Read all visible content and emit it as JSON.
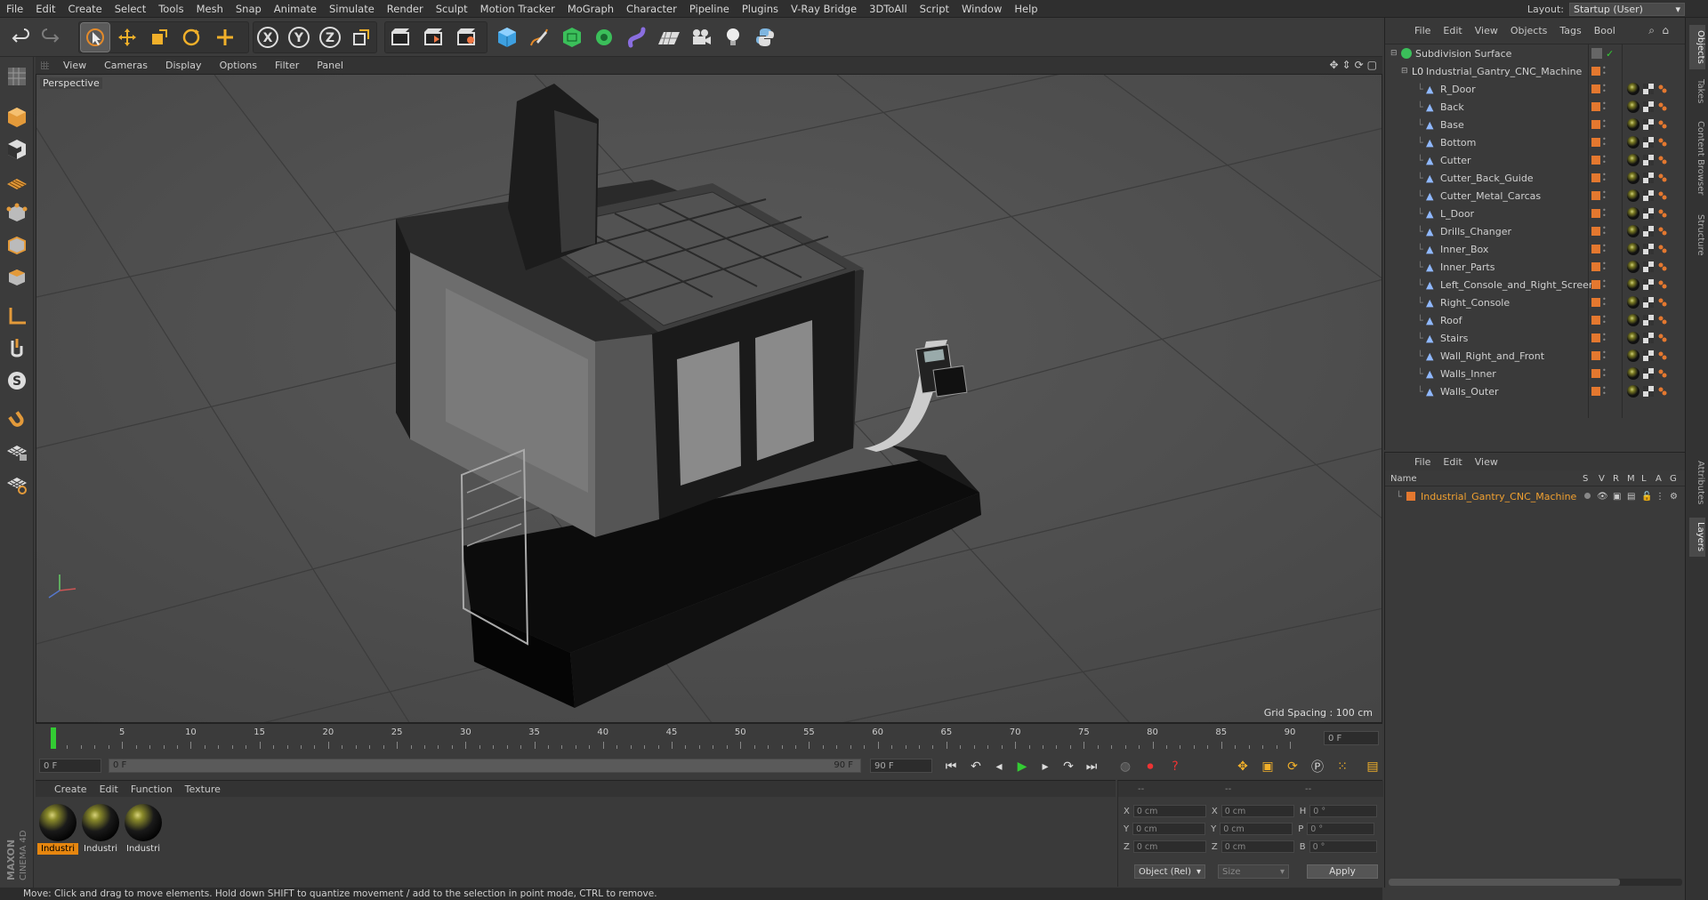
{
  "menubar": {
    "items": [
      "File",
      "Edit",
      "Create",
      "Select",
      "Tools",
      "Mesh",
      "Snap",
      "Animate",
      "Simulate",
      "Render",
      "Sculpt",
      "Motion Tracker",
      "MoGraph",
      "Character",
      "Pipeline",
      "Plugins",
      "V-Ray Bridge",
      "3DToAll",
      "Script",
      "Window",
      "Help"
    ],
    "layout_label": "Layout:",
    "layout_value": "Startup (User)"
  },
  "toolbar": {
    "icons": [
      "undo-icon",
      "redo-icon",
      "live-selection-icon",
      "move-icon",
      "scale-icon",
      "rotate-icon",
      "add-object-icon",
      "x-axis-icon",
      "y-axis-icon",
      "z-axis-icon",
      "coordinate-system-icon",
      "render-view-icon",
      "render-picture-viewer-icon",
      "edit-render-settings-icon",
      "cube-icon",
      "pen-icon",
      "subdivision-icon",
      "cloner-icon",
      "deformer-icon",
      "floor-icon",
      "camera-icon",
      "light-icon",
      "python-icon"
    ]
  },
  "viewport": {
    "menu": [
      "View",
      "Cameras",
      "Display",
      "Options",
      "Filter",
      "Panel"
    ],
    "label": "Perspective",
    "grid_spacing": "Grid Spacing : 100 cm"
  },
  "timeline": {
    "ticks": [
      "0",
      "5",
      "10",
      "15",
      "20",
      "25",
      "30",
      "35",
      "40",
      "45",
      "50",
      "55",
      "60",
      "65",
      "70",
      "75",
      "80",
      "85",
      "90"
    ],
    "current_frame": "0 F",
    "end_frame_field": "0 F",
    "range_start": "0 F",
    "range_start_inner": "0 F",
    "range_end_inner": "90 F",
    "range_end": "90 F"
  },
  "materials": {
    "menu": [
      "Create",
      "Edit",
      "Function",
      "Texture"
    ],
    "items": [
      {
        "label": "Industri",
        "selected": true
      },
      {
        "label": "Industri",
        "selected": false
      },
      {
        "label": "Industri",
        "selected": false
      }
    ]
  },
  "coords": {
    "header": [
      "--",
      "--",
      "--"
    ],
    "rows": [
      {
        "a": "X",
        "av": "0 cm",
        "b": "X",
        "bv": "0 cm",
        "c": "H",
        "cv": "0 °"
      },
      {
        "a": "Y",
        "av": "0 cm",
        "b": "Y",
        "bv": "0 cm",
        "c": "P",
        "cv": "0 °"
      },
      {
        "a": "Z",
        "av": "0 cm",
        "b": "Z",
        "bv": "0 cm",
        "c": "B",
        "cv": "0 °"
      }
    ],
    "mode": "Object (Rel)",
    "size": "Size",
    "apply": "Apply"
  },
  "objects": {
    "menu": [
      "File",
      "Edit",
      "View",
      "Objects",
      "Tags",
      "Bool"
    ],
    "root": "Subdivision Surface",
    "group": "Industrial_Gantry_CNC_Machine",
    "children": [
      "R_Door",
      "Back",
      "Base",
      "Bottom",
      "Cutter",
      "Cutter_Back_Guide",
      "Cutter_Metal_Carcas",
      "L_Door",
      "Drills_Changer",
      "Inner_Box",
      "Inner_Parts",
      "Left_Console_and_Right_Screen",
      "Right_Console",
      "Roof",
      "Stairs",
      "Wall_Right_and_Front",
      "Walls_Inner",
      "Walls_Outer"
    ]
  },
  "layers": {
    "menu": [
      "File",
      "Edit",
      "View"
    ],
    "columns": [
      "Name",
      "S",
      "V",
      "R",
      "M",
      "L",
      "A",
      "G"
    ],
    "rows": [
      "Industrial_Gantry_CNC_Machine"
    ]
  },
  "right_tabs": [
    "Objects",
    "Takes",
    "Content Browser",
    "Structure",
    "Attributes",
    "Layers"
  ],
  "status": "Move: Click and drag to move elements. Hold down SHIFT to quantize movement / add to the selection in point mode, CTRL to remove.",
  "brand": [
    "MAXON",
    "CINEMA 4D"
  ],
  "colors": {
    "accent": "#e6860f",
    "object_orange": "#e4782f",
    "layer_text": "#f0a030"
  }
}
